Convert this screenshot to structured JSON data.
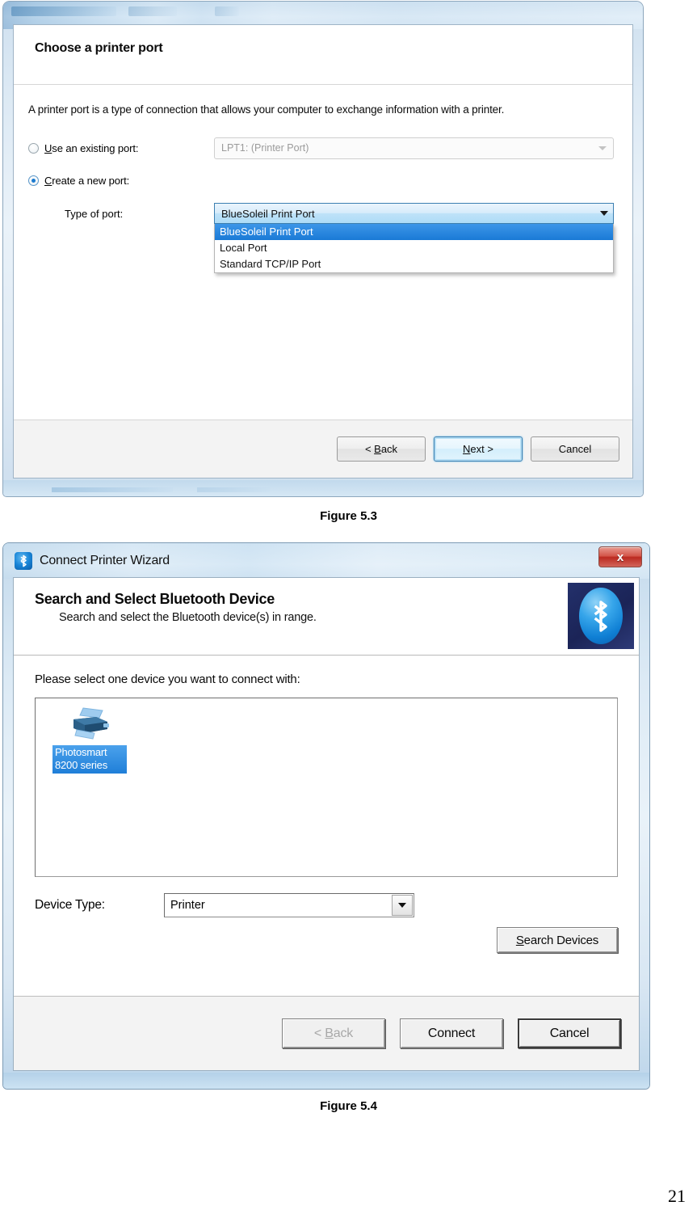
{
  "document": {
    "page_number": "21",
    "figure_1_caption": "Figure 5.3",
    "figure_2_caption": "Figure 5.4"
  },
  "printer_port_wizard": {
    "heading": "Choose a printer port",
    "description": "A printer port is a type of connection that allows your computer to exchange information with a printer.",
    "existing_port": {
      "radio_label_accel": "U",
      "radio_label_rest": "se an existing port:",
      "selected": false,
      "value": "LPT1: (Printer Port)"
    },
    "new_port": {
      "radio_label_accel": "C",
      "radio_label_rest": "reate a new port:",
      "selected": true,
      "type_label": "Type of port:",
      "value": "BlueSoleil Print Port",
      "options": [
        "BlueSoleil Print Port",
        "Local Port",
        "Standard TCP/IP Port"
      ],
      "selected_option_index": 0
    },
    "buttons": {
      "back": "< Back",
      "back_accel": "B",
      "next": "Next >",
      "next_accel": "N",
      "cancel": "Cancel"
    }
  },
  "connect_printer_wizard": {
    "window_title": "Connect Printer Wizard",
    "close_glyph": "x",
    "heading": "Search and Select Bluetooth Device",
    "subheading": "Search and select the Bluetooth device(s) in range.",
    "prompt": "Please select one device you want to connect with:",
    "devices": [
      {
        "name_line1": "Photosmart",
        "name_line2": "8200 series",
        "selected": true
      }
    ],
    "device_type": {
      "label": "Device Type:",
      "value": "Printer"
    },
    "search_button": {
      "accel": "S",
      "rest": "earch Devices"
    },
    "buttons": {
      "back": "< Back",
      "back_accel": "B",
      "back_prefix": "< ",
      "back_rest": "ack",
      "connect": "Connect",
      "cancel": "Cancel"
    }
  },
  "colors": {
    "accent_blue": "#1a7ad6",
    "selection_blue": "#1f7fd8",
    "close_red": "#bb2a20",
    "bluetooth_navy": "#23306b"
  }
}
